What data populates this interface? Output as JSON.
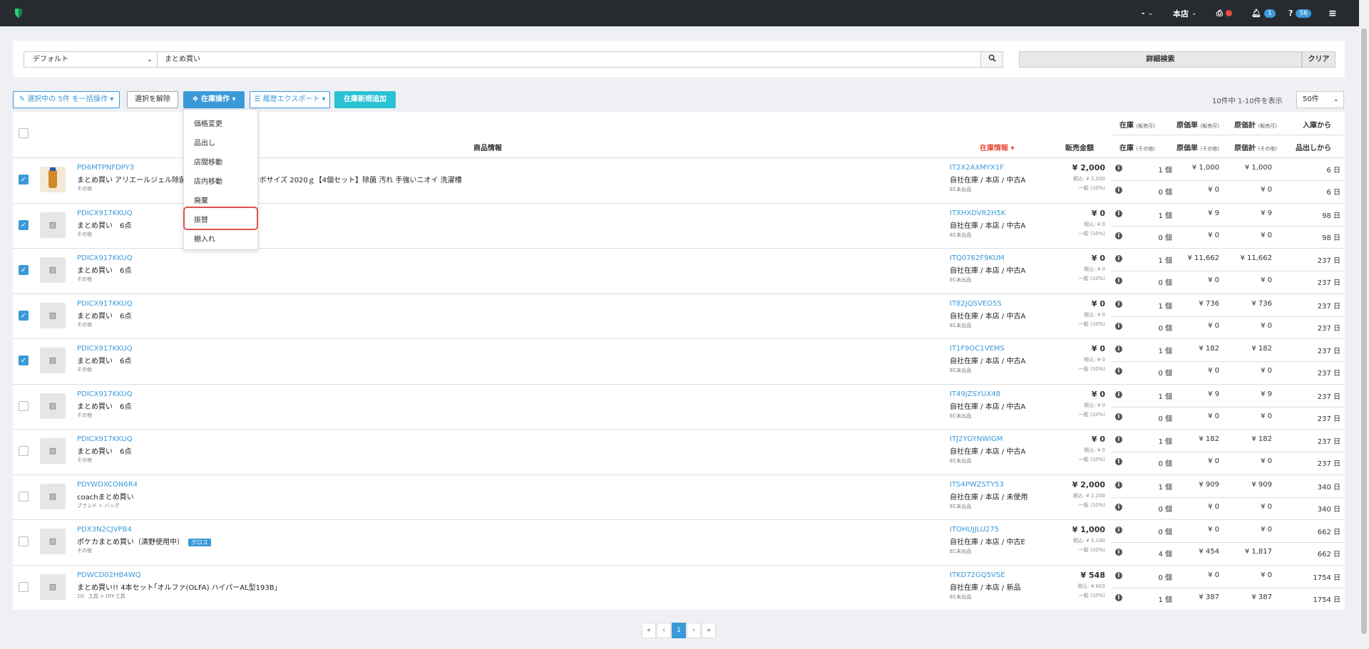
{
  "topbar": {
    "user": "-",
    "store": "本店",
    "notif_count": "1",
    "help_count": "56"
  },
  "search": {
    "preset": "デフォルト",
    "query": "まとめ買い",
    "detail": "詳細検索",
    "clear": "クリア"
  },
  "toolbar": {
    "bulk": "選択中の 5件 を一括操作 ▾",
    "deselect": "選択を解除",
    "inventory_ops": "在庫操作 ▾",
    "export": "履歴エクスポート ▾",
    "add_new": "在庫新規追加",
    "showing": "10件中 1-10件を表示",
    "per_page": "50件"
  },
  "menu": [
    "価格変更",
    "品出し",
    "店間移動",
    "店内移動",
    "廃棄",
    "振替",
    "棚入れ"
  ],
  "headers": {
    "product": "商品情報",
    "stock_info": "在庫情報 ▾",
    "sale_price": "販売金額",
    "stock": "在庫",
    "stock_sub": "(販売可)",
    "stock_other": "(その他)",
    "cost_unit": "原価単",
    "cost_unit_sub": "(販売可)",
    "cost_total": "原価計",
    "cost_total_sub": "(販売可)",
    "since_in": "入庫から",
    "since_out": "品出しから"
  },
  "rows": [
    {
      "checked": true,
      "photo": true,
      "code": "PD6MTPNFDPY3",
      "name": "まとめ買い アリエールジェル除菌プラス  ウルトラジャンボサイズ 2020ｇ【4個セット】除菌 汚れ 手強いニオイ 洗濯槽",
      "cat": "その他",
      "stock_code": "IT2X2AXMYX1F",
      "loc": "自社在庫 / 本店 / 中古A",
      "ec": "EC未出品",
      "price": "¥ 2,000",
      "tax": "税込: ¥ 2,200",
      "tax2": "一般 (10%)",
      "q1": "1 個",
      "u1": "¥ 1,000",
      "t1": "¥ 1,000",
      "d1": "6 日",
      "q2": "0 個",
      "u2": "¥ 0",
      "t2": "¥ 0",
      "d2": "6 日"
    },
    {
      "checked": true,
      "photo": false,
      "code": "PDICX917KKUQ",
      "name": "まとめ買い　6点",
      "cat": "その他",
      "stock_code": "ITXHXDVR2H5K",
      "loc": "自社在庫 / 本店 / 中古A",
      "ec": "EC未出品",
      "price": "¥ 0",
      "tax": "税込: ¥ 0",
      "tax2": "一般 (10%)",
      "q1": "1 個",
      "u1": "¥ 9",
      "t1": "¥ 9",
      "d1": "98 日",
      "q2": "0 個",
      "u2": "¥ 0",
      "t2": "¥ 0",
      "d2": "98 日"
    },
    {
      "checked": true,
      "photo": false,
      "code": "PDICX917KKUQ",
      "name": "まとめ買い　6点",
      "cat": "その他",
      "stock_code": "ITQ0762F9KUM",
      "loc": "自社在庫 / 本店 / 中古A",
      "ec": "EC未出品",
      "price": "¥ 0",
      "tax": "税込: ¥ 0",
      "tax2": "一般 (10%)",
      "q1": "1 個",
      "u1": "¥ 11,662",
      "t1": "¥ 11,662",
      "d1": "237 日",
      "q2": "0 個",
      "u2": "¥ 0",
      "t2": "¥ 0",
      "d2": "237 日"
    },
    {
      "checked": true,
      "photo": false,
      "code": "PDICX917KKUQ",
      "name": "まとめ買い　6点",
      "cat": "その他",
      "stock_code": "IT82JQSVEO5S",
      "loc": "自社在庫 / 本店 / 中古A",
      "ec": "EC未出品",
      "price": "¥ 0",
      "tax": "税込: ¥ 0",
      "tax2": "一般 (10%)",
      "q1": "1 個",
      "u1": "¥ 736",
      "t1": "¥ 736",
      "d1": "237 日",
      "q2": "0 個",
      "u2": "¥ 0",
      "t2": "¥ 0",
      "d2": "237 日"
    },
    {
      "checked": true,
      "photo": false,
      "code": "PDICX917KKUQ",
      "name": "まとめ買い　6点",
      "cat": "その他",
      "stock_code": "IT1F9OC1VEMS",
      "loc": "自社在庫 / 本店 / 中古A",
      "ec": "EC未出品",
      "price": "¥ 0",
      "tax": "税込: ¥ 0",
      "tax2": "一般 (10%)",
      "q1": "1 個",
      "u1": "¥ 182",
      "t1": "¥ 182",
      "d1": "237 日",
      "q2": "0 個",
      "u2": "¥ 0",
      "t2": "¥ 0",
      "d2": "237 日"
    },
    {
      "checked": false,
      "photo": false,
      "code": "PDICX917KKUQ",
      "name": "まとめ買い　6点",
      "cat": "その他",
      "stock_code": "IT49JZSYUX48",
      "loc": "自社在庫 / 本店 / 中古A",
      "ec": "EC未出品",
      "price": "¥ 0",
      "tax": "税込: ¥ 0",
      "tax2": "一般 (10%)",
      "q1": "1 個",
      "u1": "¥ 9",
      "t1": "¥ 9",
      "d1": "237 日",
      "q2": "0 個",
      "u2": "¥ 0",
      "t2": "¥ 0",
      "d2": "237 日"
    },
    {
      "checked": false,
      "photo": false,
      "code": "PDICX917KKUQ",
      "name": "まとめ買い　6点",
      "cat": "その他",
      "stock_code": "ITJ2YGYNWIGM",
      "loc": "自社在庫 / 本店 / 中古A",
      "ec": "EC未出品",
      "price": "¥ 0",
      "tax": "税込: ¥ 0",
      "tax2": "一般 (10%)",
      "q1": "1 個",
      "u1": "¥ 182",
      "t1": "¥ 182",
      "d1": "237 日",
      "q2": "0 個",
      "u2": "¥ 0",
      "t2": "¥ 0",
      "d2": "237 日"
    },
    {
      "checked": false,
      "photo": false,
      "code": "PDYWDXCON6R4",
      "name": "coachまとめ買い",
      "cat": "ブランド > バッグ",
      "stock_code": "ITS4PWZSTY53",
      "loc": "自社在庫 / 本店 / 未使用",
      "ec": "EC未出品",
      "price": "¥ 2,000",
      "tax": "税込: ¥ 2,200",
      "tax2": "一般 (10%)",
      "q1": "1 個",
      "u1": "¥ 909",
      "t1": "¥ 909",
      "d1": "340 日",
      "q2": "0 個",
      "u2": "¥ 0",
      "t2": "¥ 0",
      "d2": "340 日"
    },
    {
      "checked": false,
      "photo": false,
      "code": "PDX3N2CJVPB4",
      "name": "ポケカまとめ買い（清野使用中）",
      "tag": "グロス",
      "cat": "その他",
      "stock_code": "ITOHUJJLU275",
      "loc": "自社在庫 / 本店 / 中古E",
      "ec": "EC未出品",
      "price": "¥ 1,000",
      "tax": "税込: ¥ 1,100",
      "tax2": "一般 (10%)",
      "q1": "0 個",
      "u1": "¥ 0",
      "t1": "¥ 0",
      "d1": "662 日",
      "q2": "4 個",
      "u2": "¥ 454",
      "t2": "¥ 1,817",
      "d2": "662 日"
    },
    {
      "checked": false,
      "photo": false,
      "code": "PDWCD02HB4WQ",
      "name": "まとめ買い!! 4本セット｢オルファ(OLFA) ハイパーAL型193B｣",
      "cat": "10：工具 > DIY-工具",
      "stock_code": "ITKD72GQ5VSE",
      "loc": "自社在庫 / 本店 / 新品",
      "ec": "EC未出品",
      "price": "¥ 548",
      "tax": "税込: ¥ 603",
      "tax2": "一般 (10%)",
      "q1": "0 個",
      "u1": "¥ 0",
      "t1": "¥ 0",
      "d1": "1754 日",
      "q2": "1 個",
      "u2": "¥ 387",
      "t2": "¥ 387",
      "d2": "1754 日"
    }
  ],
  "pagination": {
    "first": "«",
    "prev": "‹",
    "current": "1",
    "next": "›",
    "last": "»"
  }
}
